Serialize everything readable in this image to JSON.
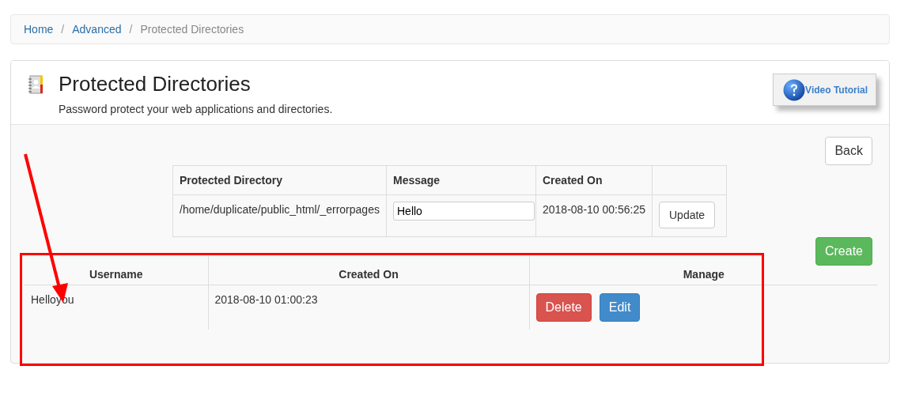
{
  "breadcrumb": [
    {
      "label": "Home",
      "selected": false
    },
    {
      "separator": "/",
      "label": "Advanced",
      "selected": false
    },
    {
      "separator": "/",
      "label": "Protected Directories",
      "selected": true
    }
  ],
  "header": {
    "title": "Protected Directories",
    "subtitle": "Password protect your web applications and directories.",
    "tutorial_button": "Video Tutorial"
  },
  "back_button": "Back",
  "directory_table": {
    "columns": [
      "Protected Directory",
      "Message",
      "Created On"
    ],
    "rows": [
      {
        "directory": "/home/duplicate/public_html/_errorpages",
        "message": "Hello",
        "created_on": "2018-08-10 00:56:25",
        "action": "Update"
      }
    ]
  },
  "create_button": "Create",
  "users_table": {
    "columns": [
      "Username",
      "Created On",
      "Manage"
    ],
    "rows": [
      {
        "username": "Helloyou",
        "created_on": "2018-08-10 01:00:23",
        "actions": [
          {
            "label": "Delete",
            "kind": "danger"
          },
          {
            "label": "Edit",
            "kind": "primary"
          }
        ]
      }
    ]
  }
}
